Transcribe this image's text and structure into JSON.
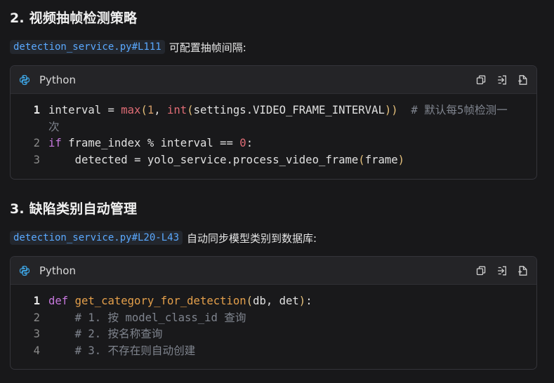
{
  "section2": {
    "heading": "2. 视频抽帧检测策略",
    "link": "detection_service.py#L111",
    "desc": "可配置抽帧间隔:",
    "code": {
      "language": "Python",
      "lines": [
        {
          "number": "1",
          "text": "interval = max(1, int(settings.VIDEO_FRAME_INTERVAL))  # 默认每5帧检测一次"
        },
        {
          "number": "2",
          "text": "if frame_index % interval == 0:"
        },
        {
          "number": "3",
          "text": "    detected = yolo_service.process_video_frame(frame)"
        }
      ]
    }
  },
  "section3": {
    "heading": "3. 缺陷类别自动管理",
    "link": "detection_service.py#L20-L43",
    "desc": "自动同步模型类别到数据库:",
    "code": {
      "language": "Python",
      "lines": [
        {
          "number": "1",
          "text": "def get_category_for_detection(db, det):"
        },
        {
          "number": "2",
          "text": "    # 1. 按 model_class_id 查询"
        },
        {
          "number": "3",
          "text": "    # 2. 按名称查询"
        },
        {
          "number": "4",
          "text": "    # 3. 不存在则自动创建"
        }
      ]
    }
  },
  "icons": {
    "language": "python-icon",
    "copy": "copy-icon",
    "insert": "insert-icon",
    "new_file": "new-file-icon"
  },
  "colors": {
    "background": "#18181a",
    "inline_code_text": "#5aa9ff",
    "keyword": "#c678dd",
    "comment": "#7f848e",
    "builtin": "#e06c75",
    "function": "#e5c07b"
  }
}
